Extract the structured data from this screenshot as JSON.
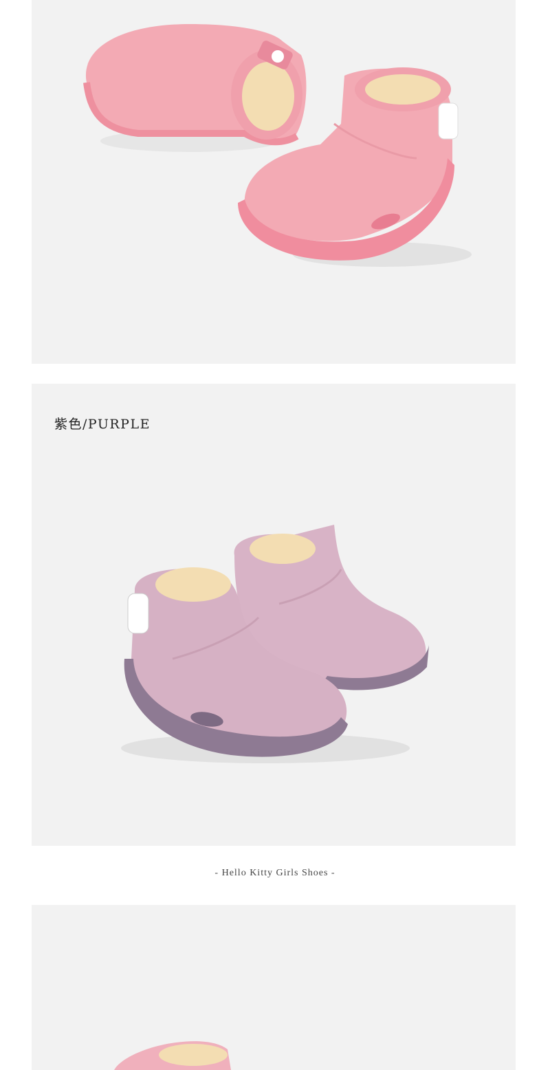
{
  "panels": [
    {
      "photo": "pink-shoes-photo"
    },
    {
      "label": "紫色/PURPLE",
      "photo": "purple-shoes-photo"
    },
    {
      "photo": "shoes-photo-partial"
    }
  ],
  "caption": "- Hello Kitty Girls Shoes -",
  "colors": {
    "page_bg": "#ffffff",
    "panel_bg": "#f2f2f2",
    "pink_upper": "#f2aab3",
    "pink_sole": "#f08d9e",
    "purple_upper": "#d6b1c4",
    "purple_sole": "#8e7a93",
    "fur": "#f3ddb2"
  }
}
